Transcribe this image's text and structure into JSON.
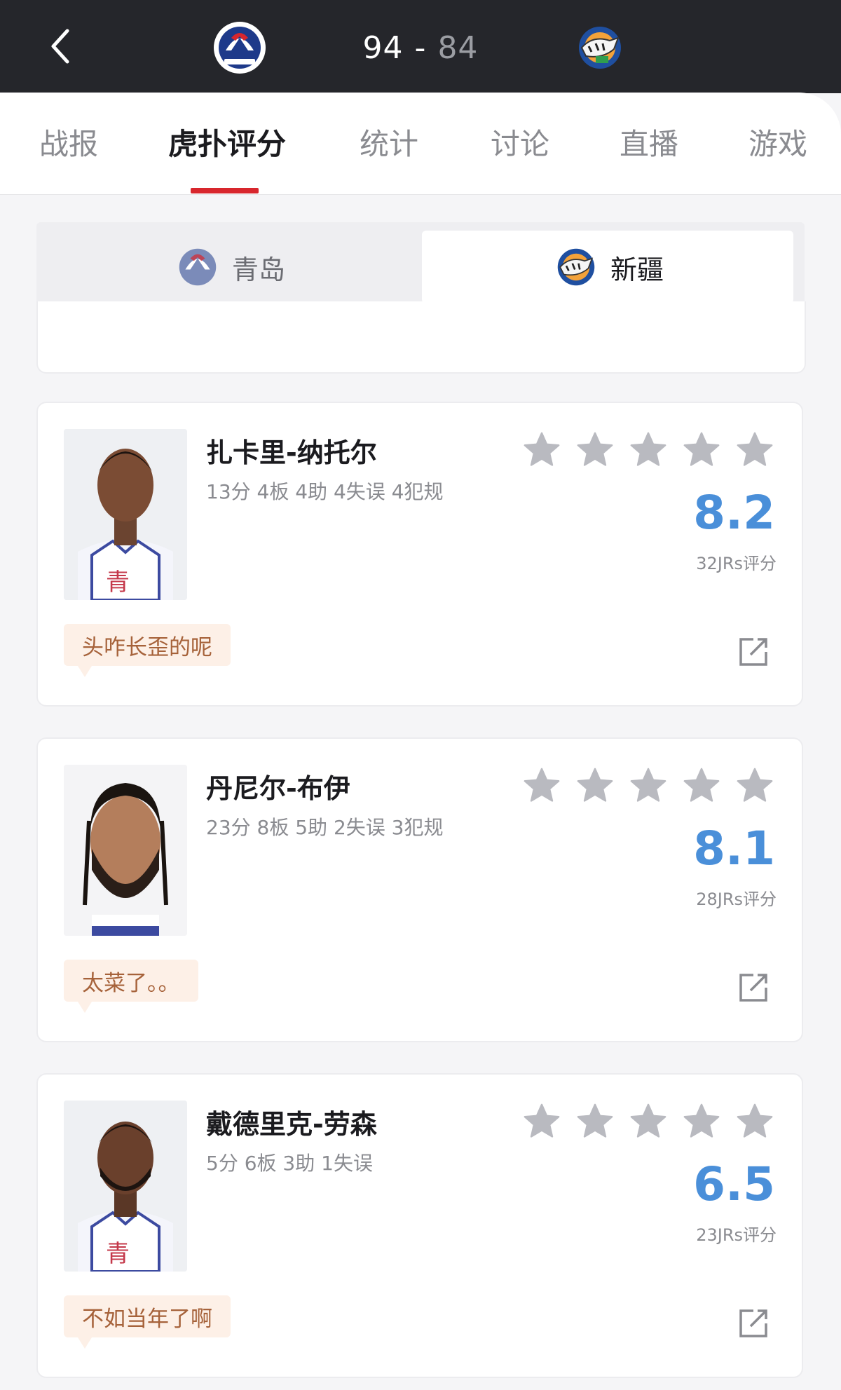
{
  "header": {
    "home_score": "94",
    "separator": "-",
    "away_score": "84",
    "home_team_logo": "qingdao-eagle-logo",
    "away_team_logo": "xinjiang-tiger-logo"
  },
  "tabs": [
    {
      "label": "战报"
    },
    {
      "label": "虎扑评分"
    },
    {
      "label": "统计"
    },
    {
      "label": "讨论"
    },
    {
      "label": "直播"
    },
    {
      "label": "游戏"
    }
  ],
  "active_tab_index": 1,
  "team_toggle": {
    "left_label": "青岛",
    "right_label": "新疆",
    "selected": "新疆"
  },
  "players": [
    {
      "name": "扎卡里-纳托尔",
      "stats": "13分 4板 4助 4失误 4犯规",
      "score": "8.2",
      "rating_count": "32JRs评分",
      "comment": "头咋长歪的呢"
    },
    {
      "name": "丹尼尔-布伊",
      "stats": "23分 8板 5助 2失误 3犯规",
      "score": "8.1",
      "rating_count": "28JRs评分",
      "comment": "太菜了。。"
    },
    {
      "name": "戴德里克-劳森",
      "stats": "5分 6板 3助 1失误",
      "score": "6.5",
      "rating_count": "23JRs评分",
      "comment": "不如当年了啊"
    }
  ],
  "colors": {
    "header_bg": "#25262b",
    "accent_red": "#d8262d",
    "score_blue": "#4a8fd9",
    "comment_text": "#a6623a",
    "star_gray": "#b9bac0"
  }
}
